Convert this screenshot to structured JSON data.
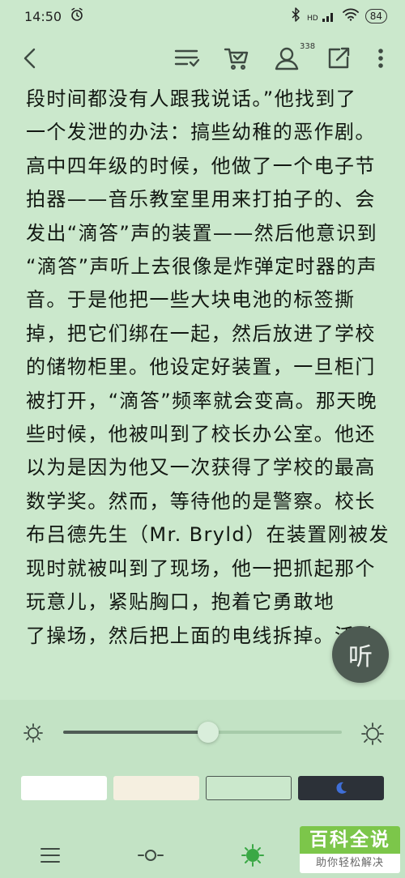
{
  "status_bar": {
    "time": "14:50",
    "signal_text": "HD",
    "battery": "84",
    "icons": [
      "alarm-icon",
      "bluetooth-icon",
      "signal-icon",
      "wifi-icon",
      "battery-icon"
    ]
  },
  "toolbar": {
    "notification_count": "338",
    "icons": [
      "back-icon",
      "catalog-icon",
      "cart-icon",
      "profile-icon",
      "share-icon",
      "more-icon"
    ]
  },
  "article": {
    "lines": [
      "段时间都没有人跟我说话。”他找到了",
      "一个发泄的办法：搞些幼稚的恶作剧。",
      "高中四年级的时候，他做了一个电子节",
      "拍器——音乐教室里用来打拍子的、会",
      "发出“滴答”声的装置——然后他意识到",
      "“滴答”声听上去很像是炸弹定时器的声",
      "音。于是他把一些大块电池的标签撕",
      "掉，把它们绑在一起，然后放进了学校",
      "的储物柜里。他设定好装置，一旦柜门",
      "被打开，“滴答”频率就会变高。那天晚",
      "些时候，他被叫到了校长办公室。他还",
      "以为是因为他又一次获得了学校的最高",
      "数学奖。然而，等待他的是警察。校长",
      "布吕德先生（Mr. Bryld）在装置刚被发",
      "现时就被叫到了现场，他一把抓起那个",
      "玩意儿，紧贴胸口，抱着它勇敢地",
      "了操场，然后把上面的电线拆掉。沃兹"
    ]
  },
  "listen_button": {
    "label": "听"
  },
  "brightness": {
    "level": 0.52
  },
  "themes": [
    {
      "name": "white",
      "color": "#ffffff"
    },
    {
      "name": "parchment",
      "color": "#f5efe0"
    },
    {
      "name": "green",
      "color": "#cbe8cc"
    },
    {
      "name": "night",
      "color": "#2c3138"
    }
  ],
  "bottom_nav": [
    "menu-icon",
    "progress-icon",
    "brightness-icon"
  ],
  "watermark": {
    "title": "百科全说",
    "subtitle": "助你轻松解决"
  }
}
